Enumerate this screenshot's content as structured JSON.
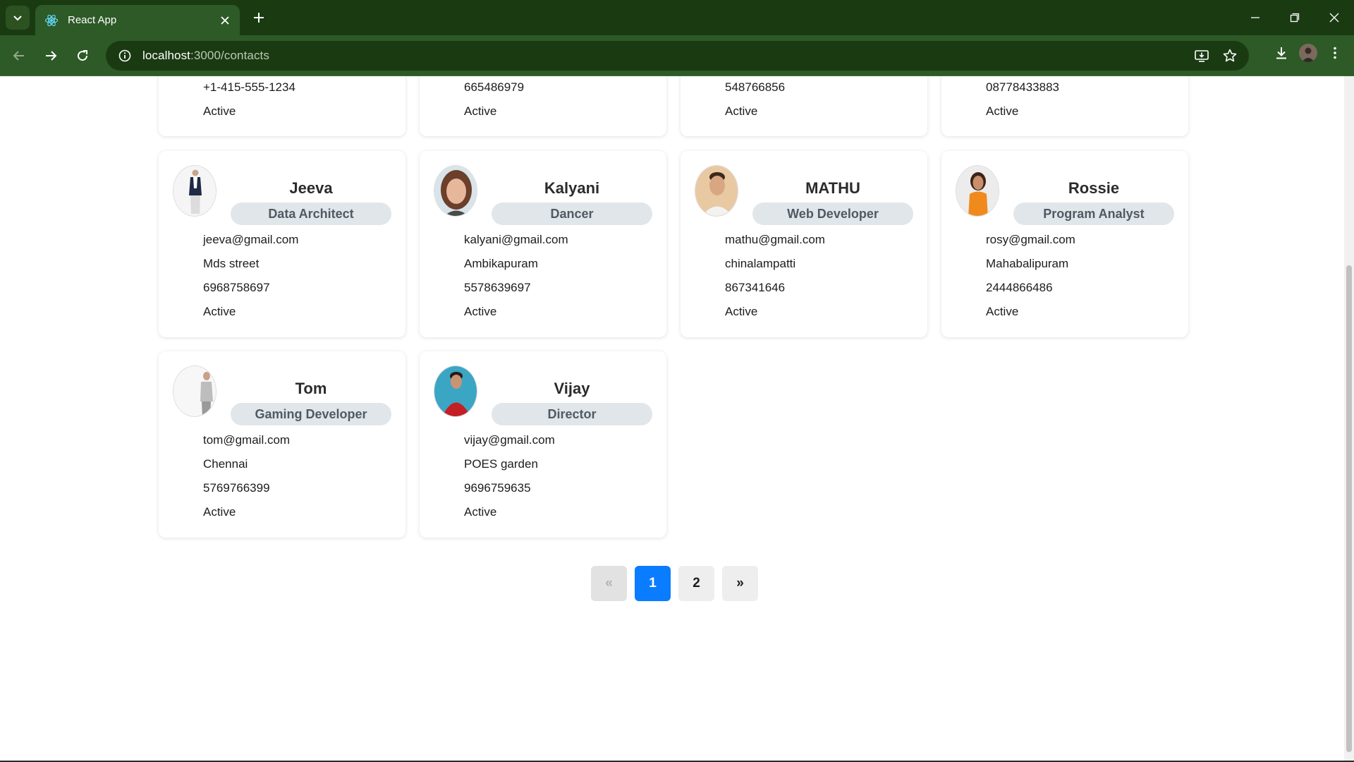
{
  "browser": {
    "tab_title": "React App",
    "url_host": "localhost",
    "url_path": ":3000/contacts"
  },
  "partial_cards": [
    {
      "phone": "+1-415-555-1234",
      "status": "Active"
    },
    {
      "phone": "665486979",
      "status": "Active"
    },
    {
      "phone": "548766856",
      "status": "Active"
    },
    {
      "phone": "08778433883",
      "status": "Active"
    }
  ],
  "contacts": [
    {
      "name": "Jeeva",
      "role": "Data Architect",
      "email": "jeeva@gmail.com",
      "address": "Mds street",
      "phone": "6968758697",
      "status": "Active"
    },
    {
      "name": "Kalyani",
      "role": "Dancer",
      "email": "kalyani@gmail.com",
      "address": "Ambikapuram",
      "phone": "5578639697",
      "status": "Active"
    },
    {
      "name": "MATHU",
      "role": "Web Developer",
      "email": "mathu@gmail.com",
      "address": "chinalampatti",
      "phone": "867341646",
      "status": "Active"
    },
    {
      "name": "Rossie",
      "role": "Program Analyst",
      "email": "rosy@gmail.com",
      "address": "Mahabalipuram",
      "phone": "2444866486",
      "status": "Active"
    },
    {
      "name": "Tom",
      "role": "Gaming Developer",
      "email": "tom@gmail.com",
      "address": "Chennai",
      "phone": "5769766399",
      "status": "Active"
    },
    {
      "name": "Vijay",
      "role": "Director",
      "email": "vijay@gmail.com",
      "address": "POES garden",
      "phone": "9696759635",
      "status": "Active"
    }
  ],
  "pagination": {
    "prev": "«",
    "pages": [
      "1",
      "2"
    ],
    "current": "1",
    "next": "»"
  },
  "colors": {
    "browser_frame": "#1a3a12",
    "browser_toolbar": "#2d5a26",
    "active_page": "#0a7cff",
    "role_badge": "#e1e6ea"
  }
}
